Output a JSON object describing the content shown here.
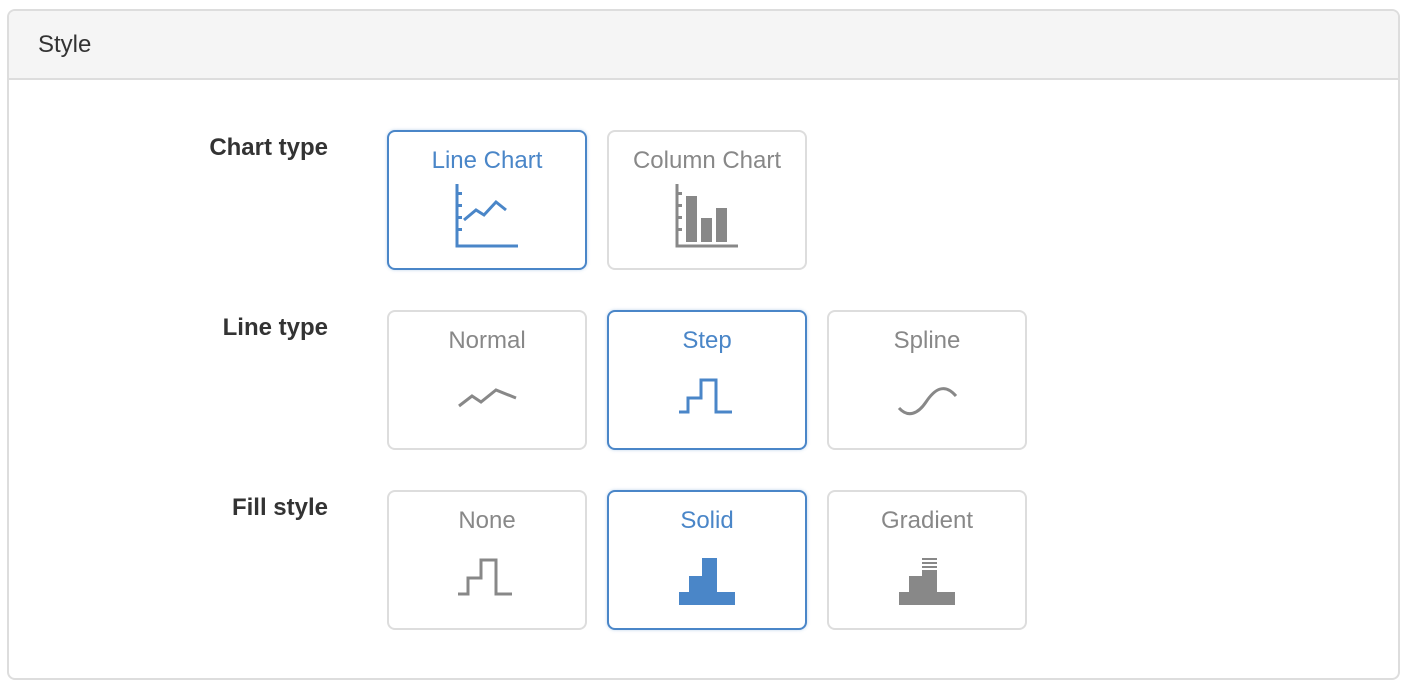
{
  "panel": {
    "title": "Style"
  },
  "colors": {
    "accent": "#4a86c8",
    "muted": "#888888",
    "border": "#dddddd",
    "header_bg": "#f5f5f5"
  },
  "rows": [
    {
      "label": "Chart type",
      "options": [
        {
          "label": "Line Chart",
          "icon": "line-chart-icon",
          "selected": true
        },
        {
          "label": "Column Chart",
          "icon": "column-chart-icon",
          "selected": false
        }
      ]
    },
    {
      "label": "Line type",
      "options": [
        {
          "label": "Normal",
          "icon": "normal-line-icon",
          "selected": false
        },
        {
          "label": "Step",
          "icon": "step-line-icon",
          "selected": true
        },
        {
          "label": "Spline",
          "icon": "spline-line-icon",
          "selected": false
        }
      ]
    },
    {
      "label": "Fill style",
      "options": [
        {
          "label": "None",
          "icon": "no-fill-icon",
          "selected": false
        },
        {
          "label": "Solid",
          "icon": "solid-fill-icon",
          "selected": true
        },
        {
          "label": "Gradient",
          "icon": "gradient-fill-icon",
          "selected": false
        }
      ]
    }
  ]
}
